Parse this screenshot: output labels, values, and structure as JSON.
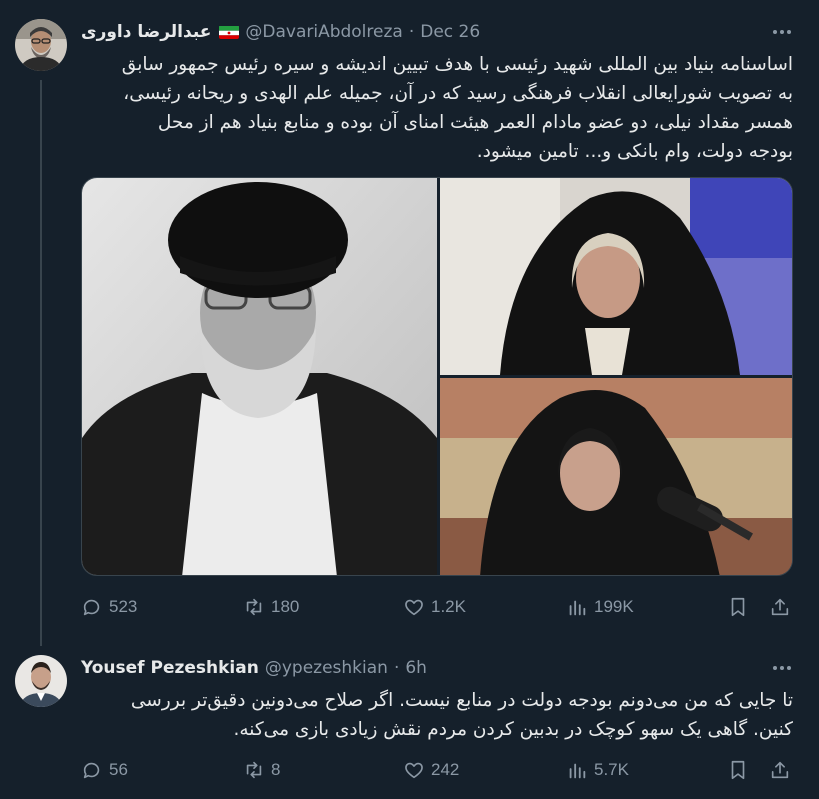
{
  "tweet1": {
    "name": "عبدالرضا داوری",
    "handle": "@DavariAbdolreza",
    "separator": "·",
    "time": "Dec 26",
    "text_lines": [
      "اساسنامه بنیاد بین المللی شهید رئیسی با هدف تبیین اندیشه و سیره رئیس جمهور سابق",
      "به تصویب شورایعالی انقلاب فرهنگی رسید که در آن، جمیله علم الهدی و ریحانه رئیسی،",
      "همسر مقداد نیلی، دو عضو مادام العمر هیئت امنای آن بوده و منابع بنیاد هم از محل",
      "بودجه دولت، وام بانکی و... تامین میشود."
    ],
    "stats": {
      "replies": "523",
      "retweets": "180",
      "likes": "1.2K",
      "views": "199K"
    }
  },
  "tweet2": {
    "name": "Yousef Pezeshkian",
    "handle": "@ypezeshkian",
    "separator": "·",
    "time": "6h",
    "text_lines": [
      "تا جایی که من می‌دونم بودجه دولت در منابع نیست. اگر صلاح می‌دونین دقیق‌تر بررسی",
      "کنین. گاهی یک سهو کوچک در بدبین کردن مردم نقش زیادی بازی می‌کنه."
    ],
    "stats": {
      "replies": "56",
      "retweets": "8",
      "likes": "242",
      "views": "5.7K"
    }
  },
  "colors": {
    "background": "#15202b",
    "text": "#e7e9ea",
    "muted": "#8b98a5",
    "divider": "#38444d"
  }
}
